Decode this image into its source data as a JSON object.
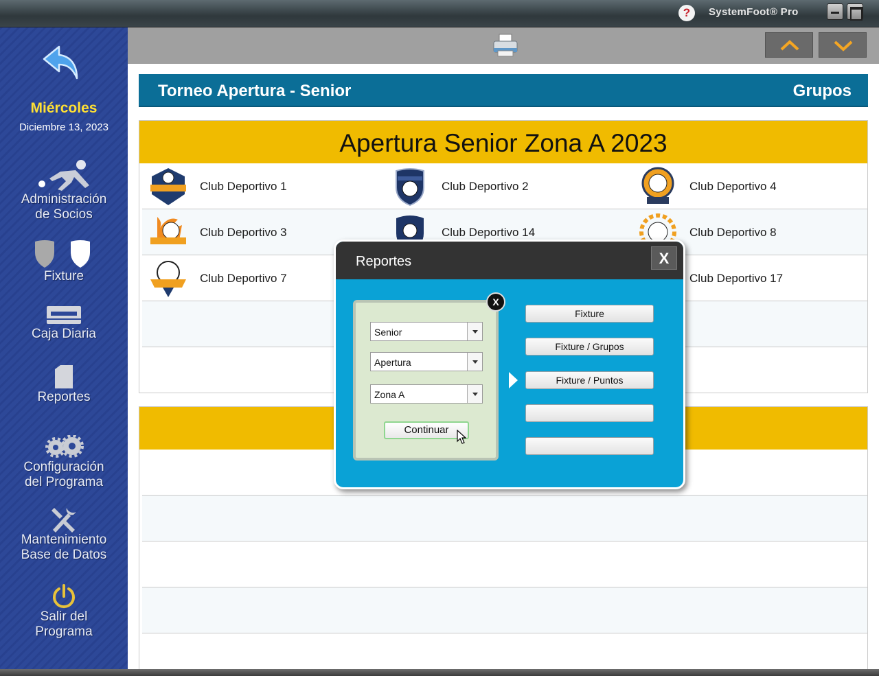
{
  "titlebar": {
    "app_name": "SystemFoot® Pro",
    "help_label": "?"
  },
  "sidebar": {
    "day": "Miércoles",
    "date": "Diciembre 13, 2023",
    "items": [
      {
        "line1": "Administración",
        "line2": "de Socios"
      },
      {
        "line1": "Fixture",
        "line2": ""
      },
      {
        "line1": "Caja Diaria",
        "line2": ""
      },
      {
        "line1": "Reportes",
        "line2": ""
      },
      {
        "line1": "Configuración",
        "line2": "del Programa"
      },
      {
        "line1": "Mantenimiento",
        "line2": "Base de Datos"
      },
      {
        "line1": "Salir del",
        "line2": "Programa"
      }
    ]
  },
  "header": {
    "title": "Torneo Apertura - Senior",
    "section": "Grupos"
  },
  "group_a": {
    "title": "Apertura Senior Zona A 2023",
    "rows": [
      [
        "Club Deportivo 1",
        "Club Deportivo 2",
        "Club Deportivo 4"
      ],
      [
        "Club Deportivo 3",
        "Club Deportivo 14",
        "Club Deportivo 8"
      ],
      [
        "Club Deportivo 7",
        "",
        "Club Deportivo 17"
      ]
    ]
  },
  "modal": {
    "title": "Reportes",
    "close_label": "X",
    "filter_close_label": "X",
    "category": "Senior",
    "tournament": "Apertura",
    "zone": "Zona A",
    "continue_label": "Continuar",
    "reports": [
      "Fixture",
      "Fixture / Grupos",
      "Fixture / Puntos",
      "",
      ""
    ]
  },
  "colors": {
    "accent_yellow": "#f0bb00",
    "header_blue": "#0b6e97",
    "modal_blue": "#0aa2d6",
    "sidebar_blue": "#2d4898"
  }
}
